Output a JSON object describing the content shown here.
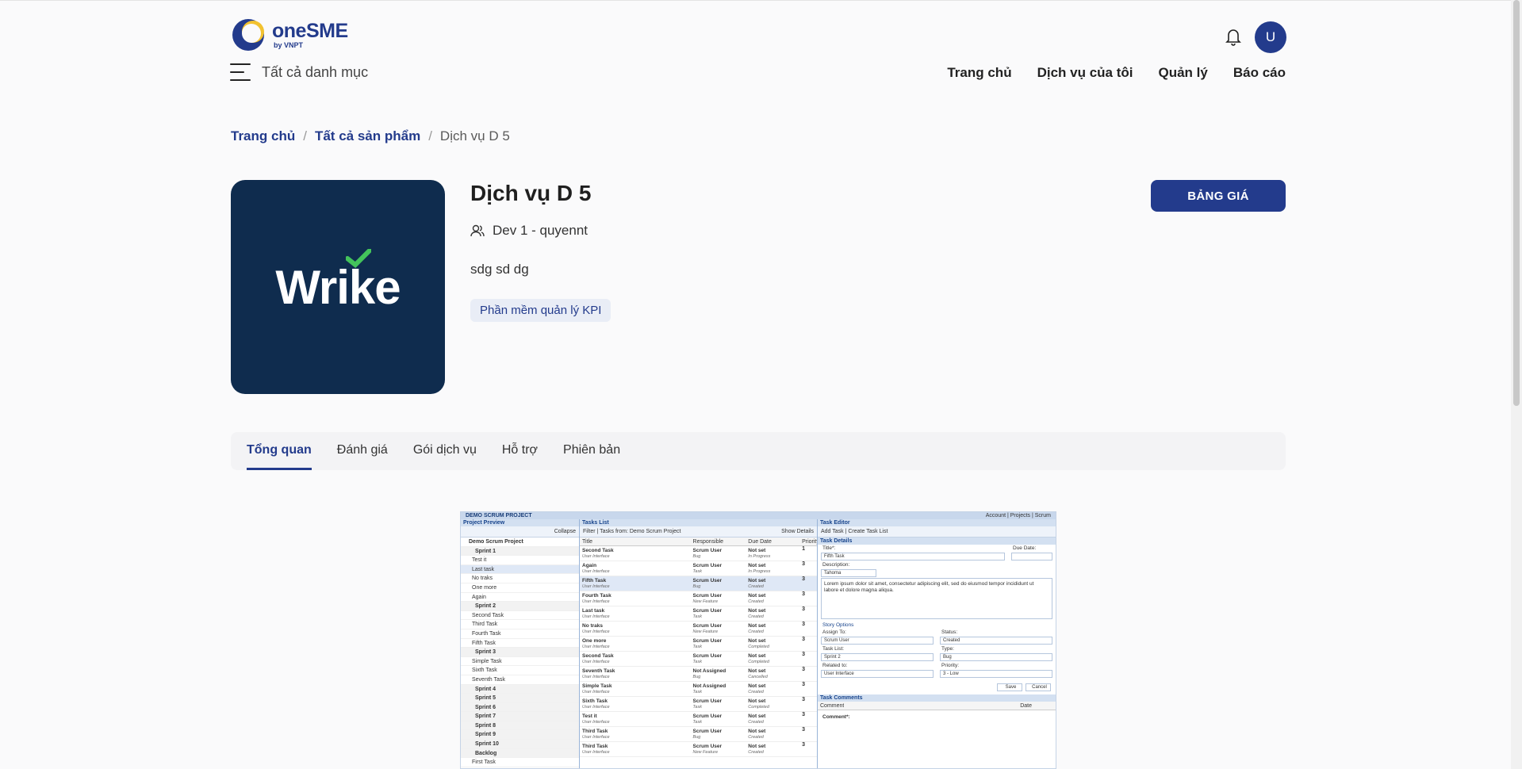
{
  "header": {
    "logo_name_one": "one",
    "logo_name_sme": "SME",
    "logo_sub": "by VNPT",
    "menu_label": "Tất cả danh mục",
    "avatar_initial": "U",
    "nav": [
      "Trang chủ",
      "Dịch vụ của tôi",
      "Quản lý",
      "Báo cáo"
    ]
  },
  "breadcrumb": {
    "home": "Trang chủ",
    "all_products": "Tất cả sản phẩm",
    "current": "Dịch vụ D 5",
    "separator": "/"
  },
  "product": {
    "logo_text": "Wrike",
    "title": "Dịch vụ D 5",
    "developer": "Dev 1 - quyennt",
    "description": "sdg sd dg",
    "tag": "Phần mềm quản lý KPI",
    "pricing_button": "BẢNG GIÁ"
  },
  "tabs": [
    "Tổng quan",
    "Đánh giá",
    "Gói dịch vụ",
    "Hỗ trợ",
    "Phiên bản"
  ],
  "active_tab": "Tổng quan",
  "screenshot": {
    "top_title": "DEMO SCRUM PROJECT",
    "top_right": "Account | Projects | Scrum",
    "left_panel": {
      "title": "Project Preview",
      "toolbar": "Collapse",
      "rows": [
        {
          "label": "Demo Scrum Project",
          "kind": "proj"
        },
        {
          "label": "Sprint 1",
          "kind": "grp"
        },
        {
          "label": "Test it",
          "kind": "item"
        },
        {
          "label": "Last task",
          "kind": "sel"
        },
        {
          "label": "No traks",
          "kind": "item"
        },
        {
          "label": "One more",
          "kind": "item"
        },
        {
          "label": "Again",
          "kind": "item"
        },
        {
          "label": "Sprint 2",
          "kind": "grp"
        },
        {
          "label": "Second Task",
          "kind": "item"
        },
        {
          "label": "Third Task",
          "kind": "item"
        },
        {
          "label": "Fourth Task",
          "kind": "item"
        },
        {
          "label": "Fifth Task",
          "kind": "item"
        },
        {
          "label": "Sprint 3",
          "kind": "grp"
        },
        {
          "label": "Simple Task",
          "kind": "item"
        },
        {
          "label": "Sixth Task",
          "kind": "item"
        },
        {
          "label": "Seventh Task",
          "kind": "item"
        },
        {
          "label": "Sprint 4",
          "kind": "grp"
        },
        {
          "label": "Sprint 5",
          "kind": "grp"
        },
        {
          "label": "Sprint 6",
          "kind": "grp"
        },
        {
          "label": "Sprint 7",
          "kind": "grp"
        },
        {
          "label": "Sprint 8",
          "kind": "grp"
        },
        {
          "label": "Sprint 9",
          "kind": "grp"
        },
        {
          "label": "Sprint 10",
          "kind": "grp"
        },
        {
          "label": "Backlog",
          "kind": "grp"
        },
        {
          "label": "First Task",
          "kind": "item"
        }
      ]
    },
    "mid_panel": {
      "title": "Tasks List",
      "toolbar": "Filter | Tasks from: Demo Scrum Project",
      "toolbar_right": "Show Details",
      "columns": [
        "Title",
        "Responsible",
        "Due Date",
        "Priority"
      ],
      "rows": [
        {
          "title": "Second Task",
          "sub": "User Interface",
          "resp": "Scrum User",
          "type": "Bug",
          "due": "Not set",
          "status": "In Progress",
          "pri": "1"
        },
        {
          "title": "Again",
          "sub": "User Interface",
          "resp": "Scrum User",
          "type": "Task",
          "due": "Not set",
          "status": "In Progress",
          "pri": "3"
        },
        {
          "title": "Fifth Task",
          "sub": "User Interface",
          "resp": "Scrum User",
          "type": "Bug",
          "due": "Not set",
          "status": "Created",
          "pri": "3"
        },
        {
          "title": "Fourth Task",
          "sub": "User Interface",
          "resp": "Scrum User",
          "type": "New Feature",
          "due": "Not set",
          "status": "Created",
          "pri": "3"
        },
        {
          "title": "Last task",
          "sub": "User Interface",
          "resp": "Scrum User",
          "type": "Task",
          "due": "Not set",
          "status": "Created",
          "pri": "3"
        },
        {
          "title": "No traks",
          "sub": "User Interface",
          "resp": "Scrum User",
          "type": "New Feature",
          "due": "Not set",
          "status": "Created",
          "pri": "3"
        },
        {
          "title": "One more",
          "sub": "User Interface",
          "resp": "Scrum User",
          "type": "Task",
          "due": "Not set",
          "status": "Completed",
          "pri": "3"
        },
        {
          "title": "Second Task",
          "sub": "User Interface",
          "resp": "Scrum User",
          "type": "Task",
          "due": "Not set",
          "status": "Completed",
          "pri": "3"
        },
        {
          "title": "Seventh Task",
          "sub": "User Interface",
          "resp": "Not Assigned",
          "type": "Bug",
          "due": "Not set",
          "status": "Cancelled",
          "pri": "3"
        },
        {
          "title": "Simple Task",
          "sub": "User Interface",
          "resp": "Not Assigned",
          "type": "Task",
          "due": "Not set",
          "status": "Created",
          "pri": "3"
        },
        {
          "title": "Sixth Task",
          "sub": "User Interface",
          "resp": "Scrum User",
          "type": "Task",
          "due": "Not set",
          "status": "Completed",
          "pri": "3"
        },
        {
          "title": "Test it",
          "sub": "User Interface",
          "resp": "Scrum User",
          "type": "Task",
          "due": "Not set",
          "status": "Created",
          "pri": "3"
        },
        {
          "title": "Third Task",
          "sub": "User Interface",
          "resp": "Scrum User",
          "type": "Bug",
          "due": "Not set",
          "status": "Created",
          "pri": "3"
        },
        {
          "title": "Third Task",
          "sub": "User Interface",
          "resp": "Scrum User",
          "type": "New Feature",
          "due": "Not set",
          "status": "Created",
          "pri": "3"
        }
      ]
    },
    "right_panel": {
      "title": "Task Editor",
      "toolbar": "Add Task | Create Task List",
      "section": "Task Details",
      "title_label": "Title*:",
      "title_value": "Fifth Task",
      "due_label": "Due Date:",
      "desc_label": "Description:",
      "font": "Tahoma",
      "desc_text": "Lorem ipsum dolor sit amet, consectetur adipiscing elit, sed do eiusmod tempor incididunt ut labore et dolore magna aliqua.",
      "story_options": "Story Options",
      "assign_label": "Assign To:",
      "assign_value": "Scrum User",
      "status_label": "Status:",
      "status_value": "Created",
      "tasklist_label": "Task List:",
      "tasklist_value": "Sprint 2",
      "type_label": "Type:",
      "type_value": "Bug",
      "related_label": "Related to:",
      "related_value": "User Interface",
      "priority_label": "Priority:",
      "priority_value": "3 - Low",
      "save": "Save",
      "cancel": "Cancel",
      "comments": "Task Comments",
      "comment_col": "Comment",
      "date_col": "Date",
      "comment_label": "Comment*:"
    }
  },
  "colors": {
    "brand": "#233b8c",
    "logo_bg": "#0f2c4e",
    "tag_bg": "#e9edf6",
    "check": "#43c35b"
  }
}
